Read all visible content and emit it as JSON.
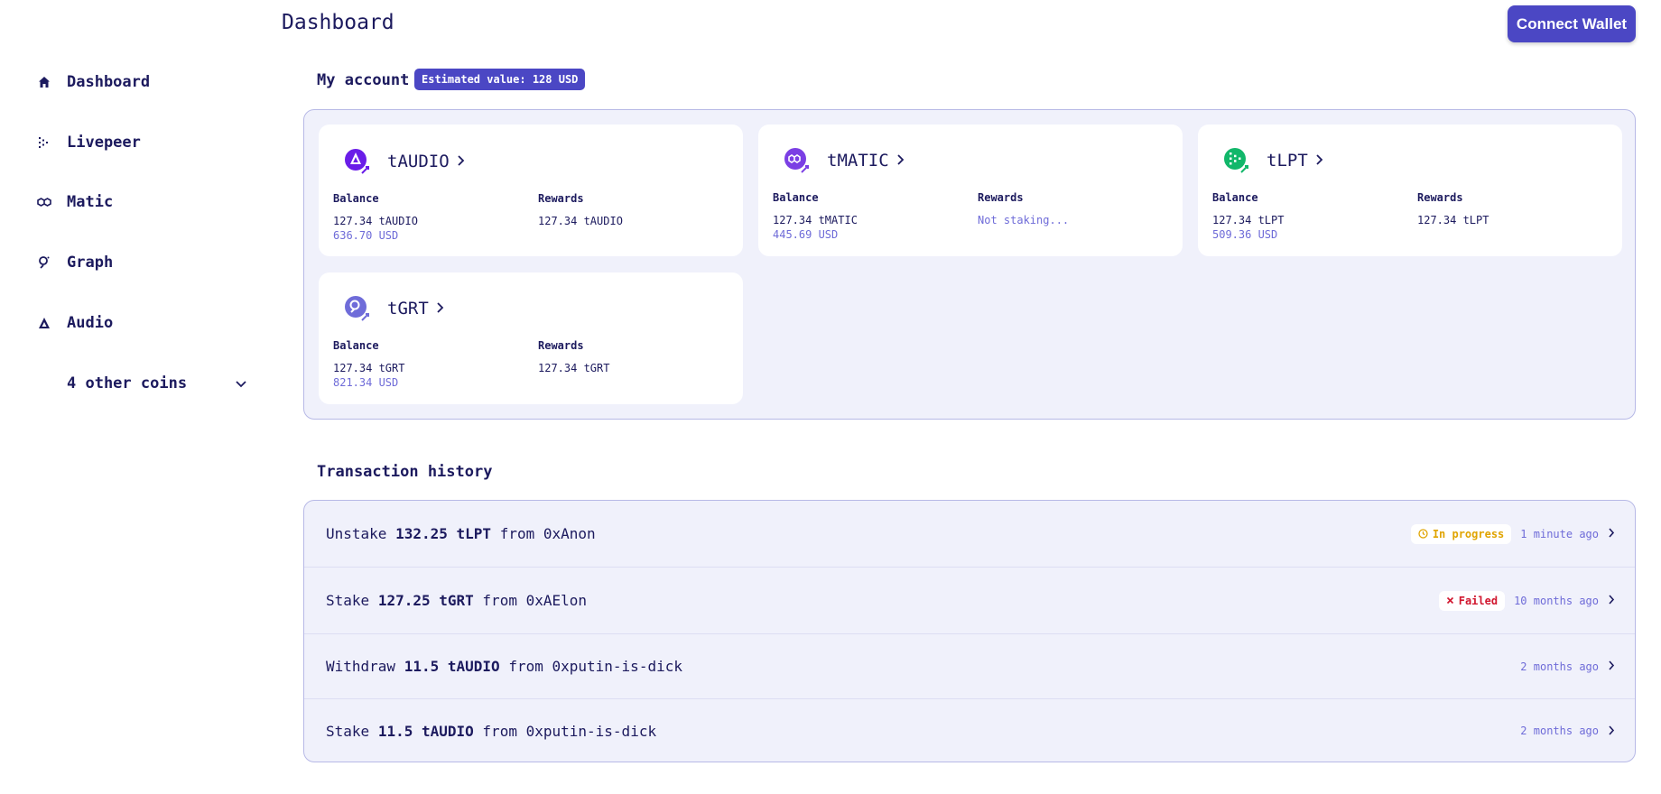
{
  "header": {
    "title": "Dashboard",
    "connect_label": "Connect Wallet"
  },
  "sidebar": {
    "items": [
      {
        "label": "Dashboard",
        "icon": "home-icon"
      },
      {
        "label": "Livepeer",
        "icon": "livepeer-icon"
      },
      {
        "label": "Matic",
        "icon": "matic-icon"
      },
      {
        "label": "Graph",
        "icon": "graph-icon"
      },
      {
        "label": "Audio",
        "icon": "audio-icon"
      }
    ],
    "more_label": "4 other coins"
  },
  "account": {
    "title": "My account",
    "estimated": "Estimated value: 128 USD",
    "balance_label": "Balance",
    "rewards_label": "Rewards",
    "coins": [
      {
        "name": "tAUDIO",
        "balance": "127.34 tAUDIO",
        "usd": "636.70 USD",
        "rewards": "127.34 tAUDIO",
        "color": "#6a1de8"
      },
      {
        "name": "tMATIC",
        "balance": "127.34 tMATIC",
        "usd": "445.69 USD",
        "rewards": "Not staking...",
        "color": "#7b3fe4"
      },
      {
        "name": "tLPT",
        "balance": "127.34 tLPT",
        "usd": "509.36 USD",
        "rewards": "127.34 tLPT",
        "color": "#12b76a"
      },
      {
        "name": "tGRT",
        "balance": "127.34 tGRT",
        "usd": "821.34 USD",
        "rewards": "127.34 tGRT",
        "color": "#6f6cd9"
      }
    ]
  },
  "transactions": {
    "title": "Transaction history",
    "rows": [
      {
        "action": "Unstake",
        "amount": "132.25 tLPT",
        "from_word": "from",
        "address": "0xAnon",
        "status": "In progress",
        "time": "1 minute ago"
      },
      {
        "action": "Stake",
        "amount": "127.25 tGRT",
        "from_word": "from",
        "address": "0xAElon",
        "status": "Failed",
        "time": "10 months ago"
      },
      {
        "action": "Withdraw",
        "amount": "11.5 tAUDIO",
        "from_word": "from",
        "address": "0xputin-is-dick",
        "status": "",
        "time": "2 months ago"
      },
      {
        "action": "Stake",
        "amount": "11.5 tAUDIO",
        "from_word": "from",
        "address": "0xputin-is-dick",
        "status": "",
        "time": "2 months ago"
      }
    ]
  },
  "colors": {
    "accent": "#4b47c4",
    "text": "#1c1a5e",
    "muted": "#6e6bd8",
    "panel": "#f0f1fb",
    "progress": "#e0a400",
    "failed": "#d1162e"
  }
}
